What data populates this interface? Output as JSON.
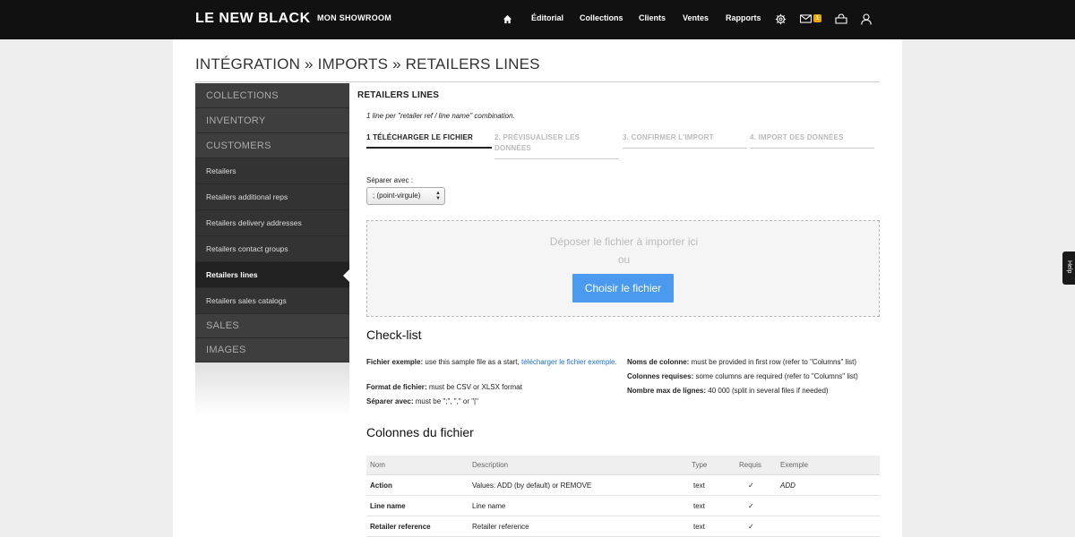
{
  "topbar": {
    "logo": "LE NEW BLACK",
    "showroom": "MON SHOWROOM",
    "nav": [
      "Éditorial",
      "Collections",
      "Clients",
      "Ventes",
      "Rapports"
    ],
    "message_count": "1",
    "icons": [
      "home-icon",
      "gear-icon",
      "mail-icon",
      "basket-icon",
      "user-icon"
    ]
  },
  "breadcrumb": "INTÉGRATION » IMPORTS » RETAILERS LINES",
  "sidebar": {
    "sections_top": [
      "COLLECTIONS",
      "INVENTORY",
      "CUSTOMERS"
    ],
    "items": [
      "Retailers",
      "Retailers additional reps",
      "Retailers delivery addresses",
      "Retailers contact groups",
      "Retailers lines",
      "Retailers sales catalogs"
    ],
    "active_item": "Retailers lines",
    "sections_bottom": [
      "SALES",
      "IMAGES"
    ]
  },
  "main": {
    "title": "RETAILERS LINES",
    "subtitle": "1 line per \"retailer ref / line name\" combination.",
    "steps": [
      "1 TÉLÉCHARGER LE FICHIER",
      "2. PRÉVISUALISER LES DONNÉES",
      "3. CONFIRMER L'IMPORT",
      "4. IMPORT DES DONNÉES"
    ],
    "separator_label": "Séparer avec :",
    "separator_value": "; (point-virgule)",
    "dropzone_text": "Déposer le fichier à importer ici",
    "dropzone_or": "ou",
    "choose_button": "Choisir le fichier"
  },
  "checklist": {
    "title": "Check-list",
    "left": [
      {
        "label": "Fichier exemple:",
        "text": "use this sample file as a start,",
        "link": "télécharger le fichier exemple."
      },
      {
        "label": "Format de fichier:",
        "text": "must be CSV or XLSX format"
      },
      {
        "label": "Séparer avec:",
        "text": "must be \";\", \",\" or \"|\""
      }
    ],
    "right": [
      {
        "label": "Noms de colonne:",
        "text": "must be provided in first row (refer to \"Columns\" list)"
      },
      {
        "label": "Colonnes requises:",
        "text": "some columns are required (refer to \"Columns\" list)"
      },
      {
        "label": "Nombre max de lignes:",
        "text": "40 000 (split in several files if needed)"
      }
    ]
  },
  "columns": {
    "title": "Colonnes du fichier",
    "headers": [
      "Nom",
      "Description",
      "Type",
      "Requis",
      "Exemple"
    ],
    "rows": [
      {
        "name": "Action",
        "description": "Values: ADD (by default) or REMOVE",
        "type": "text",
        "required": "✓",
        "example": "ADD"
      },
      {
        "name": "Line name",
        "description": "Line name",
        "type": "text",
        "required": "✓",
        "example": ""
      },
      {
        "name": "Retailer reference",
        "description": "Retailer reference",
        "type": "text",
        "required": "✓",
        "example": ""
      }
    ]
  },
  "help": "Help"
}
